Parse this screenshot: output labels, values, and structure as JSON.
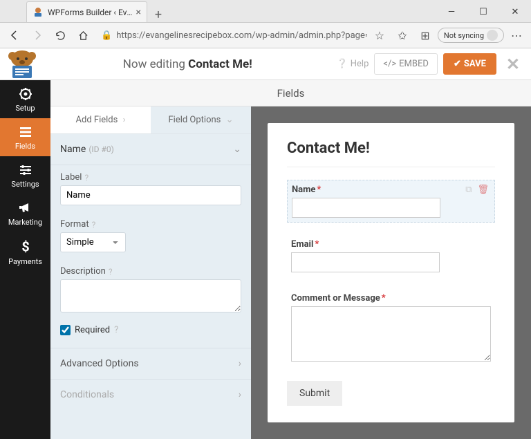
{
  "browser": {
    "tab_title": "WPForms Builder ‹ Evangeline's",
    "url": "https://evangelinesrecipebox.com/wp-admin/admin.php?page=wpforms-build...",
    "sync": "Not syncing"
  },
  "header": {
    "now_editing": "Now editing",
    "form_name": "Contact Me!",
    "help": "Help",
    "embed": "EMBED",
    "save": "SAVE"
  },
  "sidebar": {
    "items": [
      {
        "label": "Setup"
      },
      {
        "label": "Fields"
      },
      {
        "label": "Settings"
      },
      {
        "label": "Marketing"
      },
      {
        "label": "Payments"
      }
    ]
  },
  "fields_header": "Fields",
  "panel": {
    "tab_add": "Add Fields",
    "tab_options": "Field Options",
    "field_name": "Name",
    "field_id": "(ID #0)",
    "label_label": "Label",
    "label_value": "Name",
    "format_label": "Format",
    "format_value": "Simple",
    "desc_label": "Description",
    "required_label": "Required",
    "adv_label": "Advanced Options",
    "cond_label": "Conditionals"
  },
  "preview": {
    "title": "Contact Me!",
    "name_label": "Name",
    "email_label": "Email",
    "comment_label": "Comment or Message",
    "submit": "Submit"
  }
}
